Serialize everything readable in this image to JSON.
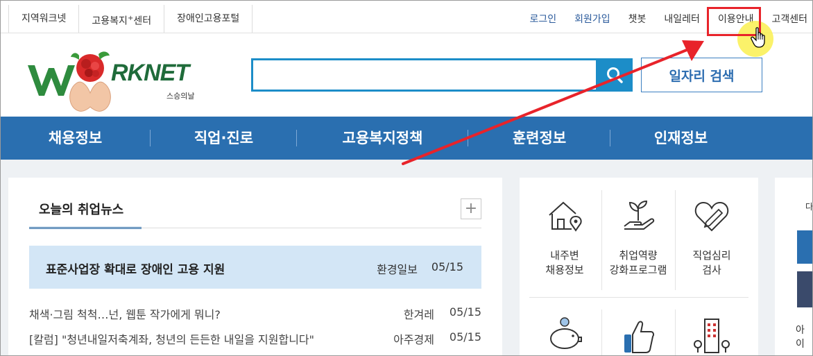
{
  "topbar": {
    "left_links": [
      {
        "label": "지역워크넷"
      },
      {
        "label": "고용복지",
        "sup": "+",
        "suffix": "센터"
      },
      {
        "label": "장애인고용포털"
      }
    ],
    "right_links": [
      {
        "label": "로그인"
      },
      {
        "label": "회원가입"
      },
      {
        "label": "챗봇"
      },
      {
        "label": "내일레터"
      },
      {
        "label": "이용안내"
      },
      {
        "label": "고객센터"
      }
    ]
  },
  "logo": {
    "text": "RKNET",
    "sub": "스승의날"
  },
  "search": {
    "placeholder": "",
    "value": "",
    "job_search_label": "일자리 검색"
  },
  "nav": {
    "items": [
      {
        "label": "채용정보"
      },
      {
        "label": "직업·진로"
      },
      {
        "label": "고용복지정책"
      },
      {
        "label": "훈련정보"
      },
      {
        "label": "인재정보"
      }
    ]
  },
  "news": {
    "tab_label": "오늘의 취업뉴스",
    "more_label": "+",
    "featured": {
      "title": "표준사업장 확대로 장애인 고용 지원",
      "source": "환경일보",
      "date": "05/15"
    },
    "items": [
      {
        "title": "채색·그림 척척…넌, 웹툰 작가에게 뭐니?",
        "source": "한겨레",
        "date": "05/15"
      },
      {
        "title": "[칼럼] \"청년내일저축계좌, 청년의 든든한 내일을 지원합니다\"",
        "source": "아주경제",
        "date": "05/15"
      }
    ]
  },
  "services": {
    "items": [
      {
        "icon": "house-location-icon",
        "line1": "내주변",
        "line2": "채용정보"
      },
      {
        "icon": "plant-hand-icon",
        "line1": "취업역량",
        "line2": "강화프로그램"
      },
      {
        "icon": "heart-icon",
        "line1": "직업심리",
        "line2": "검사"
      },
      {
        "icon": "piggy-bank-icon"
      },
      {
        "icon": "thumbs-up-icon"
      },
      {
        "icon": "building-icon"
      }
    ]
  },
  "right_panel": {
    "text_top": "다",
    "text_bottom": "아이"
  },
  "colors": {
    "nav_bg": "#2a6fb0",
    "search_border": "#1c8dc8",
    "featured_bg": "#d3e6f6",
    "highlight": "#e8232a",
    "logo_green": "#1f6b3a"
  }
}
